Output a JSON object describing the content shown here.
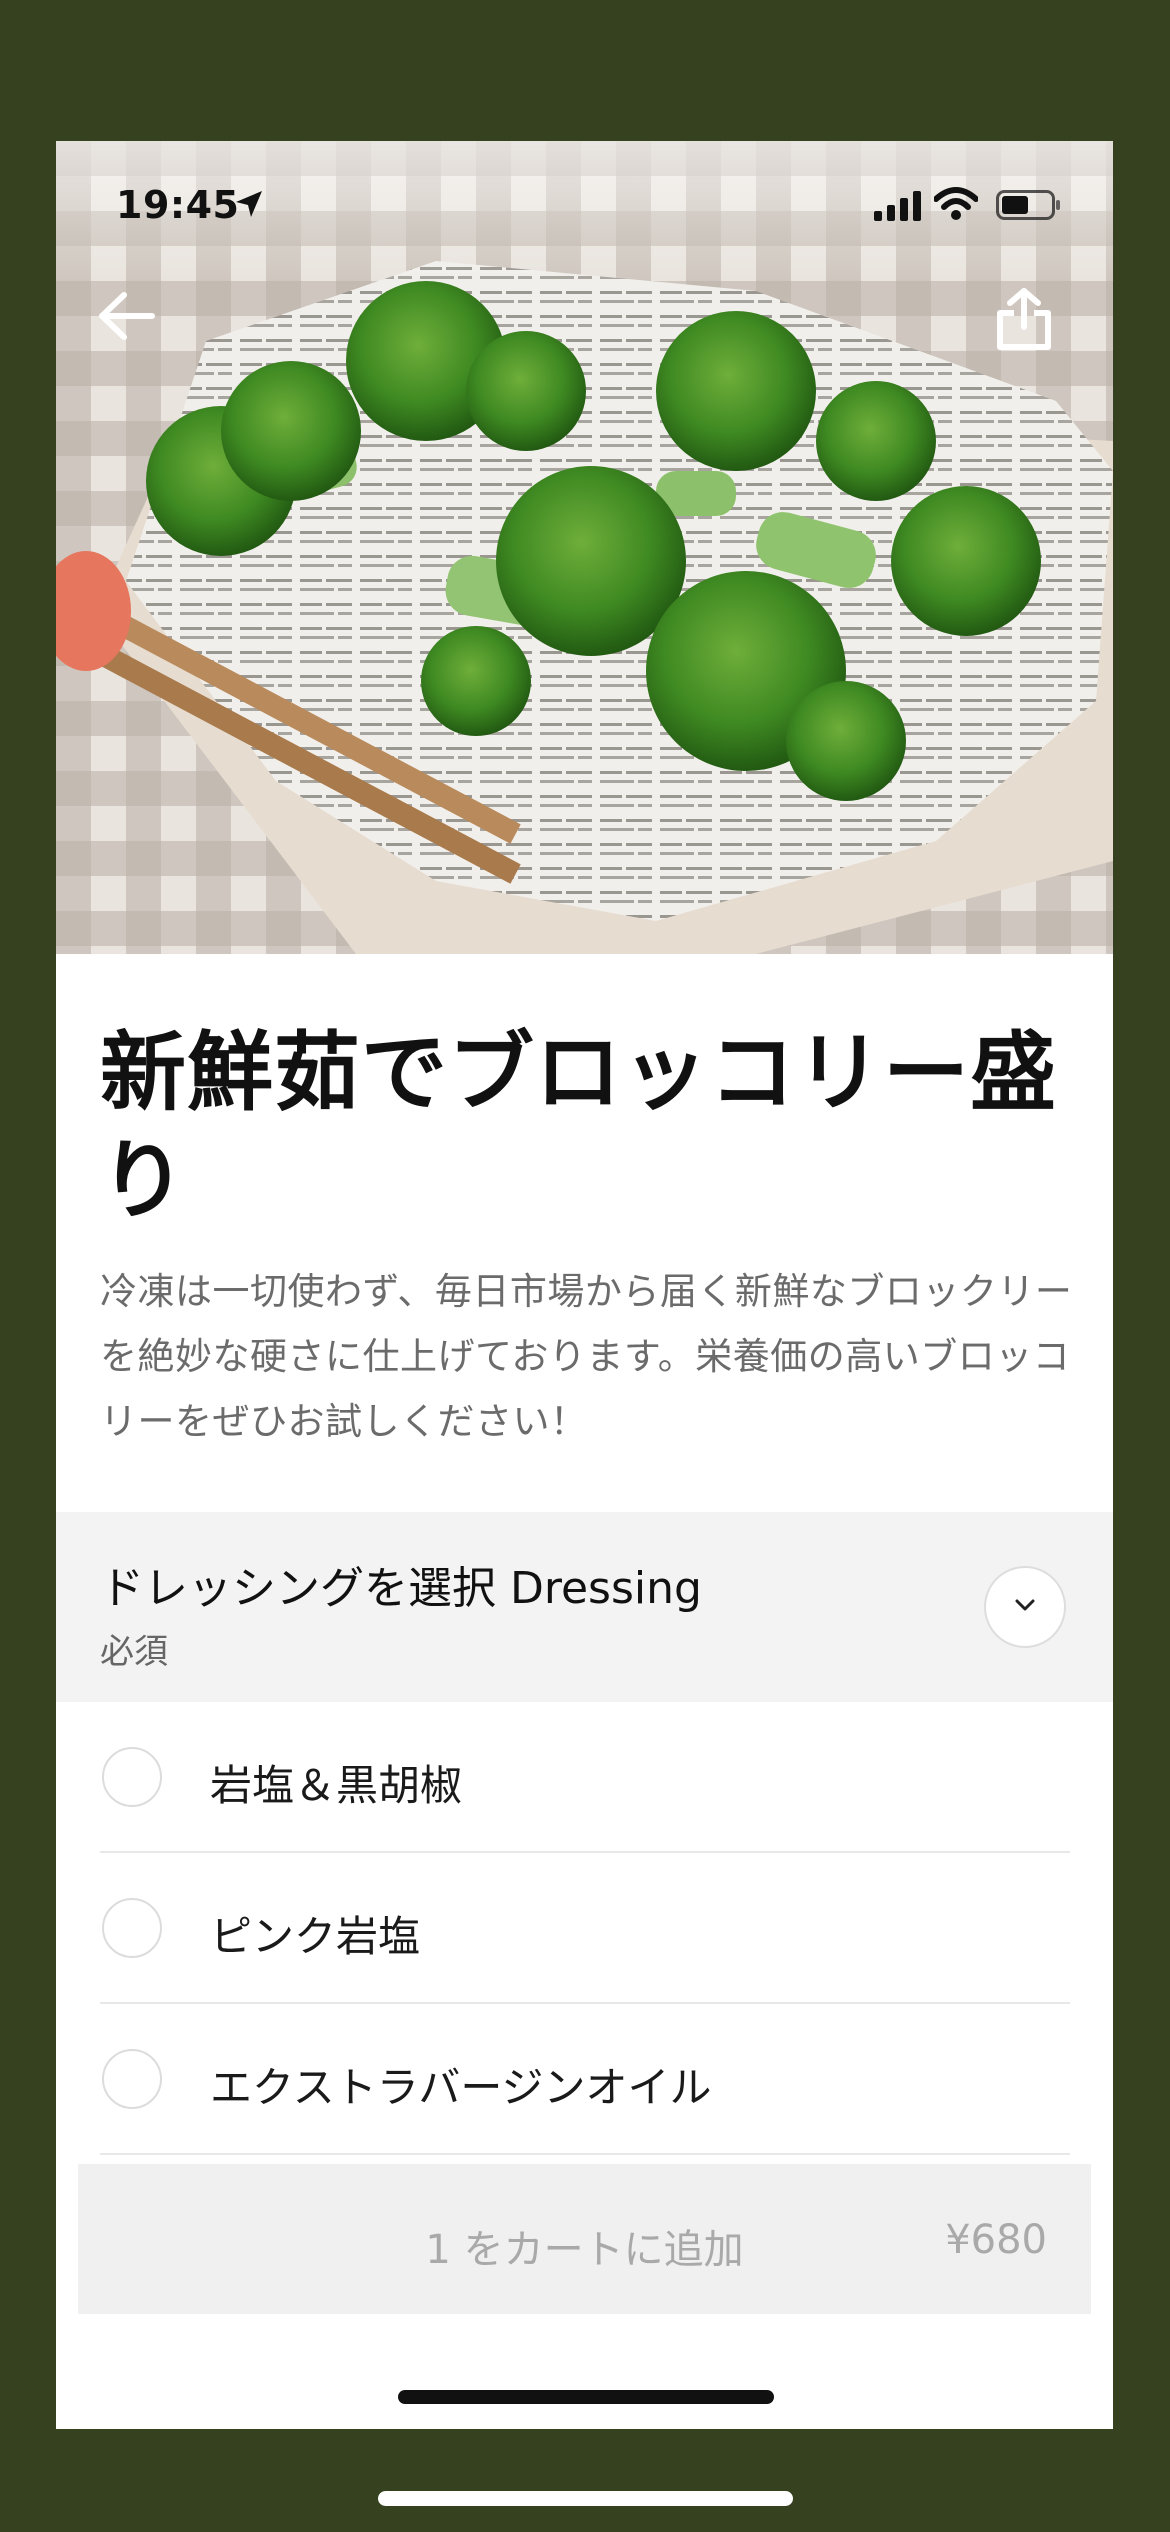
{
  "status_bar": {
    "time": "19:45"
  },
  "product": {
    "title": "新鮮茹でブロッコリー盛り",
    "description": "冷凍は一切使わず、毎日市場から届く新鮮なブロックリーを絶妙な硬さに仕上げております。栄養価の高いブロッコリーをぜひお試しください！"
  },
  "option_group": {
    "title": "ドレッシングを選択 Dressing",
    "required_label": "必須",
    "options": [
      {
        "label": "岩塩＆黒胡椒"
      },
      {
        "label": "ピンク岩塩"
      },
      {
        "label": "エクストラバージンオイル"
      }
    ]
  },
  "cart": {
    "label": "1 をカートに追加",
    "price": "¥680"
  },
  "icons": {
    "back": "arrow-left-icon",
    "share": "share-icon",
    "collapse": "chevron-down-icon",
    "location": "location-arrow-icon",
    "signal": "cellular-signal-icon",
    "wifi": "wifi-icon",
    "battery": "battery-icon"
  },
  "colors": {
    "outer_background": "#36421f",
    "button_disabled_bg": "#f0f0f0",
    "button_disabled_text": "#a9a9a9",
    "section_header_bg": "#f3f3f3"
  }
}
